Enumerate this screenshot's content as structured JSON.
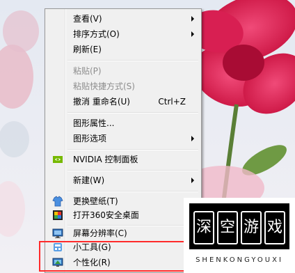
{
  "menu": {
    "view": "查看(V)",
    "sort": "排序方式(O)",
    "refresh": "刷新(E)",
    "paste": "粘贴(P)",
    "paste_shortcut": "粘贴快捷方式(S)",
    "undo": "撤消 重命名(U)",
    "undo_shortcut": "Ctrl+Z",
    "graphics_properties": "图形属性...",
    "graphics_options": "图形选项",
    "nvidia": "NVIDIA 控制面板",
    "new": "新建(W)",
    "change_wallpaper": "更换壁纸(T)",
    "open_360": "打开360安全桌面",
    "screen_resolution": "屏幕分辨率(C)",
    "gadgets": "小工具(G)",
    "personalize": "个性化(R)"
  },
  "watermark": {
    "chars": [
      "深",
      "空",
      "游",
      "戏"
    ],
    "text": "SHENKONGYOUXI"
  },
  "colors": {
    "highlight_border": "#ff2a2a",
    "menu_bg": "#f0f0f0",
    "flower": "#e8265a"
  }
}
